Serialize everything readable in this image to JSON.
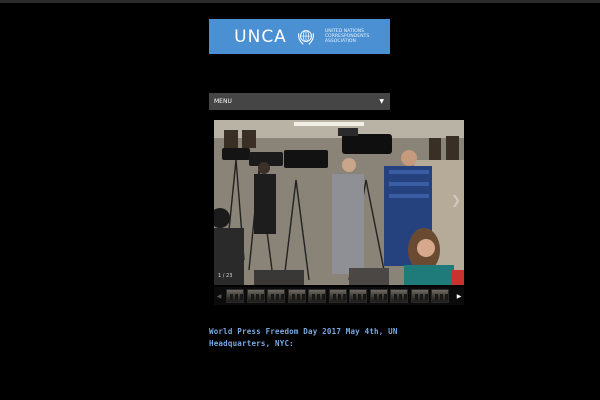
{
  "header": {
    "logo_abbr": "UNCA",
    "logo_full": "UNITED NATIONS CORRESPONDENTS ASSOCIATION",
    "logo_color": "#4a90d2",
    "emblem_icon": "un-wreath-globe-icon"
  },
  "nav": {
    "menu_label": "MENU",
    "menu_icon": "chevron-down-icon"
  },
  "gallery": {
    "counter": "1 / 23",
    "next_icon": "chevron-right-icon",
    "strip_prev_icon": "triangle-left-icon",
    "strip_next_icon": "triangle-right-icon",
    "thumbnail_count": 11
  },
  "article": {
    "caption": "World Press Freedom Day 2017 May 4th, UN Headquarters, NYC:",
    "caption_color": "#78a9e4"
  }
}
